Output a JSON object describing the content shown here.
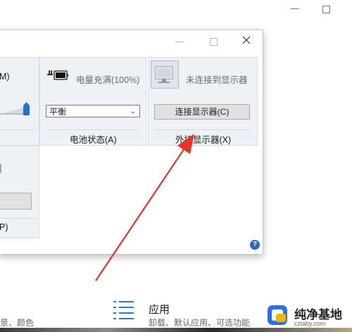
{
  "brightness": {
    "label_fragment": "M)"
  },
  "battery": {
    "status_text": "电量充满(100%)",
    "plan_value": "平衡",
    "tile_label": "电池状态(A)"
  },
  "display": {
    "status_text": "未连接到显示器",
    "connect_button": "连接显示器(C)",
    "tile_label": "外接显示器(X)"
  },
  "presentation": {
    "label_fragment": "P)",
    "top_fragment": "]"
  },
  "help": {
    "glyph": "?"
  },
  "settings": {
    "apps_title": "应用",
    "apps_description": "卸载、默认应用、可选功能",
    "left_fragment": "景、颜色"
  },
  "watermark": {
    "text": "纯净基地",
    "url": "czlaby.com"
  },
  "colors": {
    "arrow": "#e8322b",
    "accent": "#1976d2",
    "tile_bg": "#eef1f6"
  }
}
